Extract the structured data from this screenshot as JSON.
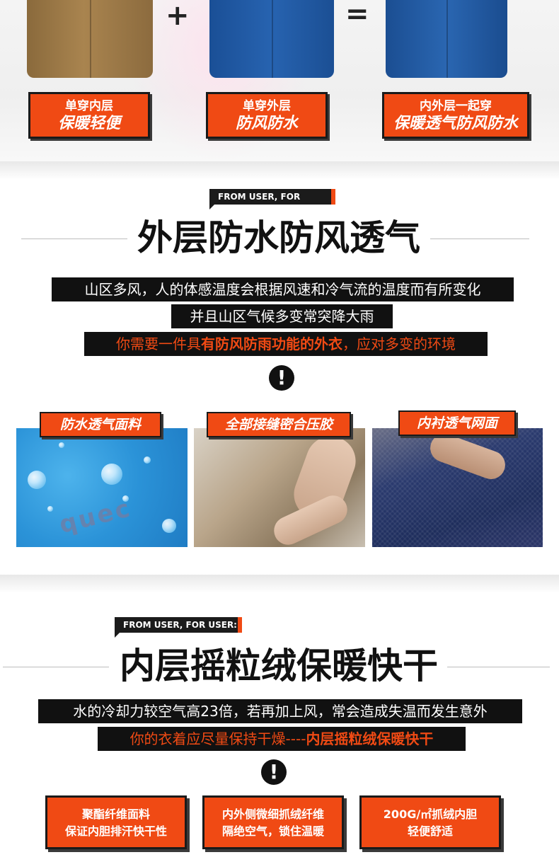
{
  "top": {
    "plus": "+",
    "equals": "=",
    "combos": [
      {
        "line1": "单穿内层",
        "line2": "保暖轻便"
      },
      {
        "line1": "单穿外层",
        "line2": "防风防水"
      },
      {
        "line1": "内外层一起穿",
        "line2": "保暖透气防风防水"
      }
    ]
  },
  "section1": {
    "tag": "FROM USER, FOR USER:",
    "title": "外层防水防风透气",
    "line1": "山区多风，人的体感温度会根据风速和冷气流的温度而有所变化",
    "line2": "并且山区气候多变常突降大雨",
    "line3_pre": "你需要一件具",
    "line3_hl": "有防风防雨功能的外衣",
    "line3_post": "，应对多变的环境",
    "warn": "!",
    "features": [
      {
        "label": "防水透气面料",
        "brand": "quec"
      },
      {
        "label": "全部接缝密合压胶"
      },
      {
        "label": "内衬透气网面"
      }
    ]
  },
  "section2": {
    "tag": "FROM USER, FOR USER:",
    "title": "内层摇粒绒保暖快干",
    "line1": "水的冷却力较空气高23倍，若再加上风，常会造成失温而发生意外",
    "line2_pre": "你的衣着应尽量保持干燥----",
    "line2_hl": "内层摇粒绒保暖快干",
    "warn": "!",
    "features": [
      {
        "line1": "聚酯纤维面料",
        "line2": "保证内胆排汗快干性"
      },
      {
        "line1": "内外侧微细抓绒纤维",
        "line2": "隔绝空气，锁住温暖"
      },
      {
        "line1": "200G/㎡抓绒内胆",
        "line2": "轻便舒适"
      }
    ]
  },
  "colors": {
    "accent": "#f04a14",
    "dark": "#111111"
  }
}
